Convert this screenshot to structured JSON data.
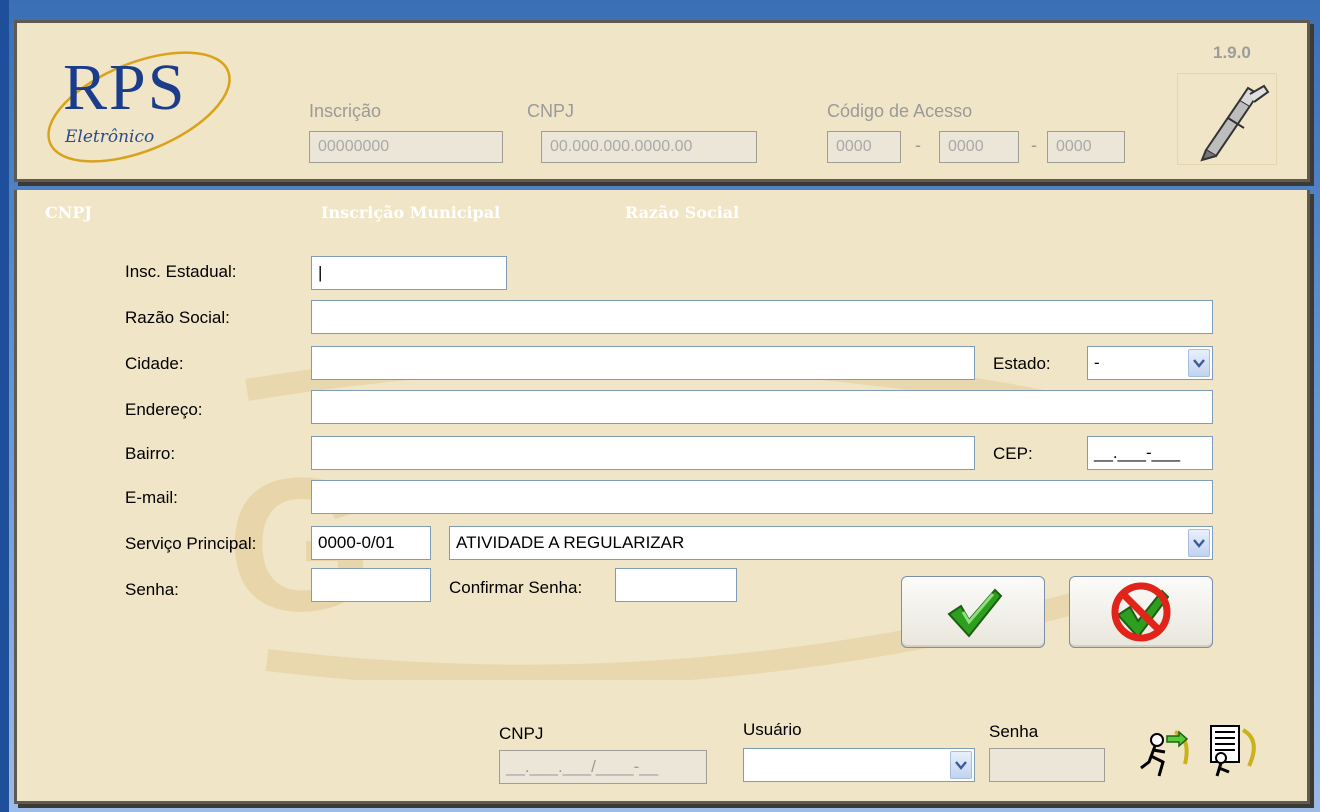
{
  "header": {
    "logo": {
      "title": "RPS",
      "subtitle": "Eletrônico"
    },
    "version": "1.9.0",
    "inscricao": {
      "label": "Inscrição",
      "value": "00000000"
    },
    "cnpj": {
      "label": "CNPJ",
      "value": "00.000.000.0000.00"
    },
    "codigo": {
      "label": "Código de Acesso",
      "part1": "0000",
      "part2": "0000",
      "part3": "0000",
      "sep": "-"
    },
    "tool_icon": "pen-tool-icon"
  },
  "form": {
    "columns": {
      "cnpj": "CNPJ",
      "inscricao_municipal": "Inscrição Municipal",
      "razao_social": "Razão Social"
    },
    "insc_estadual": {
      "label": "Insc. Estadual:",
      "value": "|"
    },
    "razao_social": {
      "label": "Razão Social:",
      "value": ""
    },
    "cidade": {
      "label": "Cidade:",
      "value": ""
    },
    "estado": {
      "label": "Estado:",
      "value": "-"
    },
    "endereco": {
      "label": "Endereço:",
      "value": ""
    },
    "bairro": {
      "label": "Bairro:",
      "value": ""
    },
    "cep": {
      "label": "CEP:",
      "value": "__.___-___"
    },
    "email": {
      "label": "E-mail:",
      "value": ""
    },
    "servico": {
      "label": "Serviço Principal:",
      "code": "0000-0/01",
      "description": "ATIVIDADE A REGULARIZAR"
    },
    "senha": {
      "label": "Senha:",
      "value": ""
    },
    "confirmar_senha": {
      "label": "Confirmar Senha:",
      "value": ""
    },
    "confirm_icon": "checkmark-icon",
    "cancel_icon": "cancel-check-icon"
  },
  "login": {
    "cnpj": {
      "label": "CNPJ",
      "value": "__.___.___/____-__"
    },
    "usuario": {
      "label": "Usuário",
      "value": ""
    },
    "senha": {
      "label": "Senha",
      "value": ""
    },
    "login_icon": "login-runner-icon",
    "register_icon": "register-icon"
  },
  "colors": {
    "panel": "#f1e5c7",
    "border": "#5e5a52",
    "logo_blue": "#1a3c8b",
    "check_green": "#2e9e1f",
    "cancel_red": "#e2231a"
  }
}
